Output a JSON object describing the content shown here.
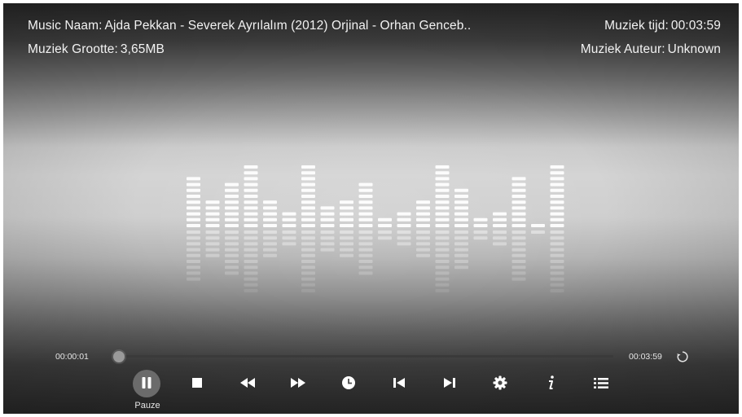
{
  "info": {
    "name_label": "Music Naam:",
    "name_value": "Ajda Pekkan - Severek Ayrılalım (2012) Orjinal - Orhan Genceb..",
    "size_label": "Muziek Grootte:",
    "size_value": "3,65MB",
    "time_label": "Muziek tijd:",
    "time_value": "00:03:59",
    "author_label": "Muziek Auteur:",
    "author_value": "Unknown"
  },
  "progress": {
    "elapsed": "00:00:01",
    "total": "00:03:59",
    "fraction": 0.004
  },
  "controls": {
    "pause_caption": "Pauze",
    "buttons": [
      "pause-icon",
      "stop-icon",
      "rewind-icon",
      "fast-forward-icon",
      "clock-icon",
      "skip-previous-icon",
      "skip-next-icon",
      "settings-gear-icon",
      "info-icon",
      "playlist-icon"
    ]
  },
  "equalizer": {
    "levels": [
      9,
      5,
      8,
      11,
      5,
      3,
      11,
      4,
      5,
      8,
      2,
      3,
      5,
      11,
      7,
      2,
      3,
      9,
      1,
      11
    ],
    "max_level": 11
  },
  "colors": {
    "text": "#f2f2f2",
    "bar": "#ffffff",
    "control_icon": "#ffffff"
  }
}
